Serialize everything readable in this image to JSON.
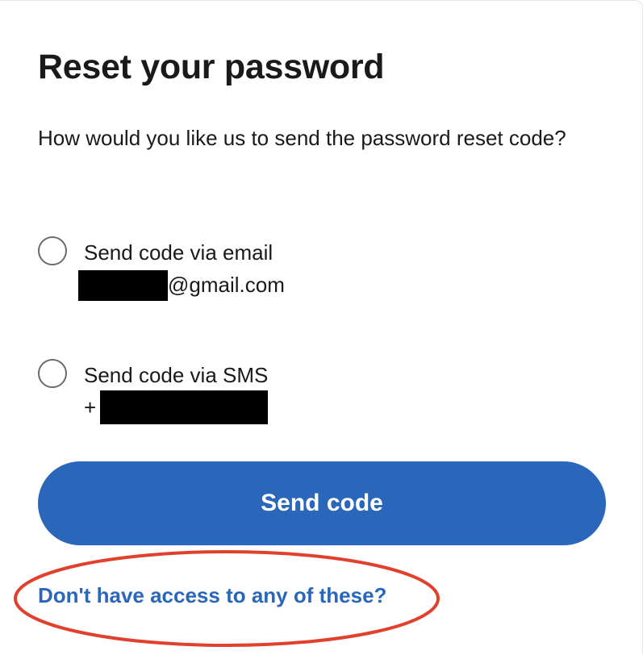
{
  "page": {
    "title": "Reset your password",
    "prompt": "How would you like us to send the password reset code?"
  },
  "options": [
    {
      "label": "Send code via email",
      "detail": "@gmail.com",
      "selected": false
    },
    {
      "label": "Send code via SMS",
      "detail": "+",
      "selected": false
    }
  ],
  "actions": {
    "send_label": "Send code",
    "help_link": "Don't have access to any of these?"
  },
  "colors": {
    "accent": "#2a67bb",
    "annotation": "#e0402c",
    "text": "#1a1a1a"
  }
}
